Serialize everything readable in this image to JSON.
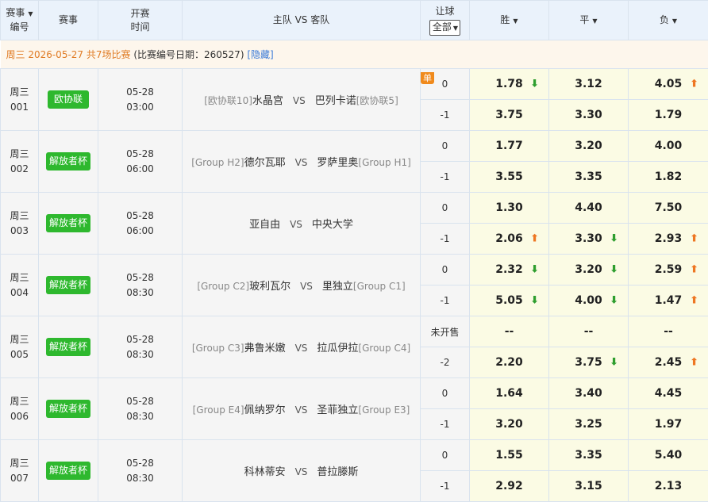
{
  "header": {
    "col_id": [
      "赛事",
      "编号"
    ],
    "col_league": "赛事",
    "col_time": [
      "开赛",
      "时间"
    ],
    "col_teams": "主队 VS 客队",
    "col_handicap": "让球",
    "handicap_filter": "全部",
    "col_win": "胜",
    "col_draw": "平",
    "col_lose": "负"
  },
  "info": {
    "date": "周三 2026-05-27 共7场比赛",
    "note": " (比赛编号日期：260527) ",
    "hide_link": "[隐藏]"
  },
  "colors": {
    "up": "#ee7622",
    "down": "#2e9e2e",
    "league_badge": "#2eb82e",
    "odds_bg": "#fbfbe4"
  },
  "matches": [
    {
      "week": "周三",
      "num": "001",
      "league": "欧协联",
      "date": "05-28",
      "time": "03:00",
      "home_rank": "[欧协联10]",
      "home": "水晶宫",
      "away": "巴列卡诺",
      "away_rank": "[欧协联5]",
      "single_tag": "单",
      "rows": [
        {
          "hc": "0",
          "odds": [
            {
              "v": "1.78",
              "t": "down"
            },
            {
              "v": "3.12",
              "t": ""
            },
            {
              "v": "4.05",
              "t": "up"
            }
          ]
        },
        {
          "hc": "-1",
          "odds": [
            {
              "v": "3.75",
              "t": ""
            },
            {
              "v": "3.30",
              "t": ""
            },
            {
              "v": "1.79",
              "t": ""
            }
          ]
        }
      ]
    },
    {
      "week": "周三",
      "num": "002",
      "league": "解放者杯",
      "date": "05-28",
      "time": "06:00",
      "home_rank": "[Group H2]",
      "home": "德尔瓦耶",
      "away": "罗萨里奥",
      "away_rank": "[Group H1]",
      "single_tag": "",
      "rows": [
        {
          "hc": "0",
          "odds": [
            {
              "v": "1.77",
              "t": ""
            },
            {
              "v": "3.20",
              "t": ""
            },
            {
              "v": "4.00",
              "t": ""
            }
          ]
        },
        {
          "hc": "-1",
          "odds": [
            {
              "v": "3.55",
              "t": ""
            },
            {
              "v": "3.35",
              "t": ""
            },
            {
              "v": "1.82",
              "t": ""
            }
          ]
        }
      ]
    },
    {
      "week": "周三",
      "num": "003",
      "league": "解放者杯",
      "date": "05-28",
      "time": "06:00",
      "home_rank": "",
      "home": "亚自由",
      "away": "中央大学",
      "away_rank": "",
      "single_tag": "",
      "rows": [
        {
          "hc": "0",
          "odds": [
            {
              "v": "1.30",
              "t": ""
            },
            {
              "v": "4.40",
              "t": ""
            },
            {
              "v": "7.50",
              "t": ""
            }
          ]
        },
        {
          "hc": "-1",
          "odds": [
            {
              "v": "2.06",
              "t": "up"
            },
            {
              "v": "3.30",
              "t": "down"
            },
            {
              "v": "2.93",
              "t": "up"
            }
          ]
        }
      ]
    },
    {
      "week": "周三",
      "num": "004",
      "league": "解放者杯",
      "date": "05-28",
      "time": "08:30",
      "home_rank": "[Group C2]",
      "home": "玻利瓦尔",
      "away": "里独立",
      "away_rank": "[Group C1]",
      "single_tag": "",
      "rows": [
        {
          "hc": "0",
          "odds": [
            {
              "v": "2.32",
              "t": "down"
            },
            {
              "v": "3.20",
              "t": "down"
            },
            {
              "v": "2.59",
              "t": "up"
            }
          ]
        },
        {
          "hc": "-1",
          "odds": [
            {
              "v": "5.05",
              "t": "down"
            },
            {
              "v": "4.00",
              "t": "down"
            },
            {
              "v": "1.47",
              "t": "up"
            }
          ]
        }
      ]
    },
    {
      "week": "周三",
      "num": "005",
      "league": "解放者杯",
      "date": "05-28",
      "time": "08:30",
      "home_rank": "[Group C3]",
      "home": "弗鲁米嫩",
      "away": "拉瓜伊拉",
      "away_rank": "[Group C4]",
      "single_tag": "",
      "rows": [
        {
          "hc": "未开售",
          "odds": [
            {
              "v": "--",
              "t": ""
            },
            {
              "v": "--",
              "t": ""
            },
            {
              "v": "--",
              "t": ""
            }
          ]
        },
        {
          "hc": "-2",
          "odds": [
            {
              "v": "2.20",
              "t": ""
            },
            {
              "v": "3.75",
              "t": "down"
            },
            {
              "v": "2.45",
              "t": "up"
            }
          ]
        }
      ]
    },
    {
      "week": "周三",
      "num": "006",
      "league": "解放者杯",
      "date": "05-28",
      "time": "08:30",
      "home_rank": "[Group E4]",
      "home": "佩纳罗尔",
      "away": "圣菲独立",
      "away_rank": "[Group E3]",
      "single_tag": "",
      "rows": [
        {
          "hc": "0",
          "odds": [
            {
              "v": "1.64",
              "t": ""
            },
            {
              "v": "3.40",
              "t": ""
            },
            {
              "v": "4.45",
              "t": ""
            }
          ]
        },
        {
          "hc": "-1",
          "odds": [
            {
              "v": "3.20",
              "t": ""
            },
            {
              "v": "3.25",
              "t": ""
            },
            {
              "v": "1.97",
              "t": ""
            }
          ]
        }
      ]
    },
    {
      "week": "周三",
      "num": "007",
      "league": "解放者杯",
      "date": "05-28",
      "time": "08:30",
      "home_rank": "",
      "home": "科林蒂安",
      "away": "普拉滕斯",
      "away_rank": "",
      "single_tag": "",
      "rows": [
        {
          "hc": "0",
          "odds": [
            {
              "v": "1.55",
              "t": ""
            },
            {
              "v": "3.35",
              "t": ""
            },
            {
              "v": "5.40",
              "t": ""
            }
          ]
        },
        {
          "hc": "-1",
          "odds": [
            {
              "v": "2.92",
              "t": ""
            },
            {
              "v": "3.15",
              "t": ""
            },
            {
              "v": "2.13",
              "t": ""
            }
          ]
        }
      ]
    }
  ]
}
